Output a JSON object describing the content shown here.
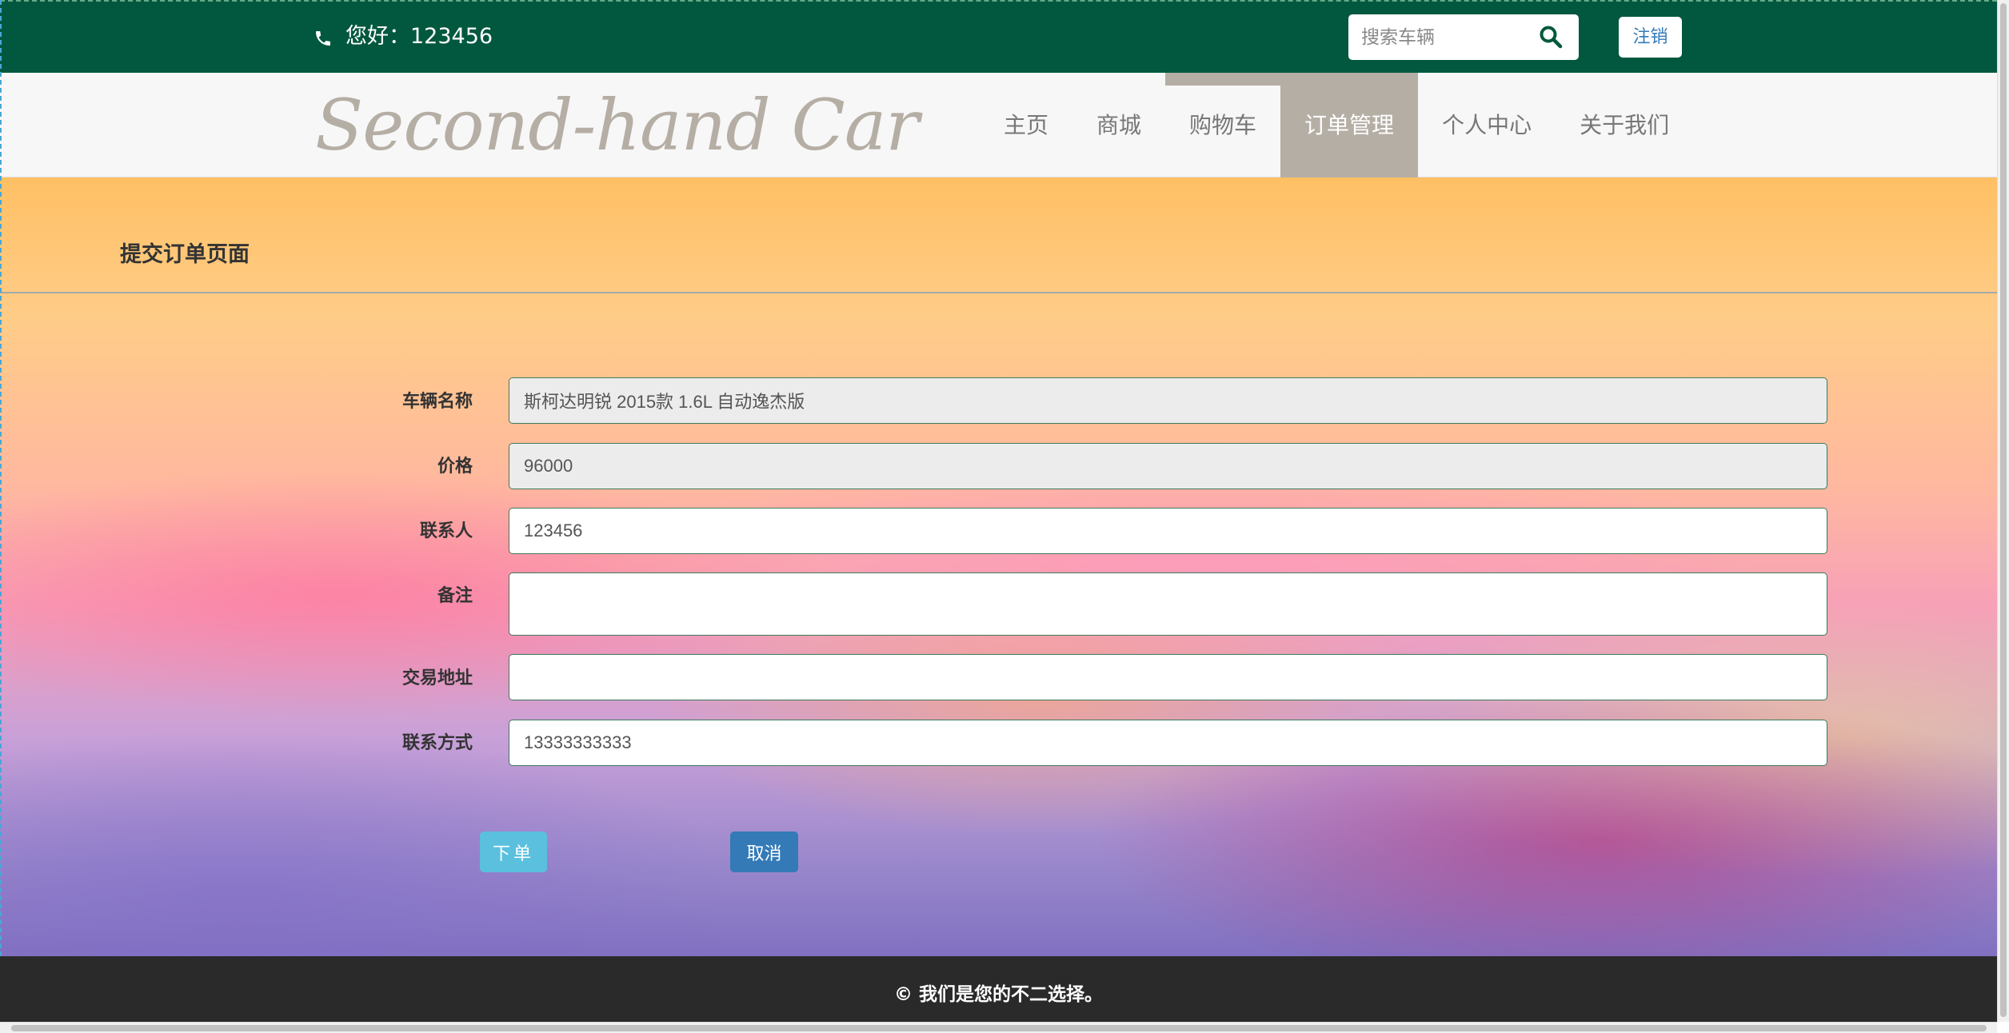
{
  "topbar": {
    "greeting": "您好：123456",
    "search_placeholder": "搜索车辆",
    "logout_label": "注销",
    "icons": {
      "phone": "phone-icon",
      "search": "search-icon"
    }
  },
  "nav": {
    "logo": "Second-hand Car",
    "items": [
      {
        "label": "主页"
      },
      {
        "label": "商城"
      },
      {
        "label": "购物车"
      },
      {
        "label": "订单管理"
      },
      {
        "label": "个人中心"
      },
      {
        "label": "关于我们"
      }
    ],
    "active": "订单管理"
  },
  "page": {
    "heading": "提交订单页面"
  },
  "form": {
    "vehicle_name": {
      "label": "车辆名称",
      "value": "斯柯达明锐 2015款 1.6L 自动逸杰版"
    },
    "price": {
      "label": "价格",
      "value": "96000"
    },
    "contact_person": {
      "label": "联系人",
      "value": "123456"
    },
    "remarks": {
      "label": "备注",
      "value": ""
    },
    "trade_address": {
      "label": "交易地址",
      "value": ""
    },
    "contact_phone": {
      "label": "联系方式",
      "value": "13333333333"
    },
    "order_button": "下单",
    "cancel_button": "取消"
  },
  "footer": {
    "text": "© 我们是您的不二选择。"
  },
  "colors": {
    "topbar": "#02583e",
    "nav_active": "#b5aea5",
    "order_button": "#5bc0de",
    "cancel_button": "#337ab7",
    "footer": "#2a2a2a"
  }
}
